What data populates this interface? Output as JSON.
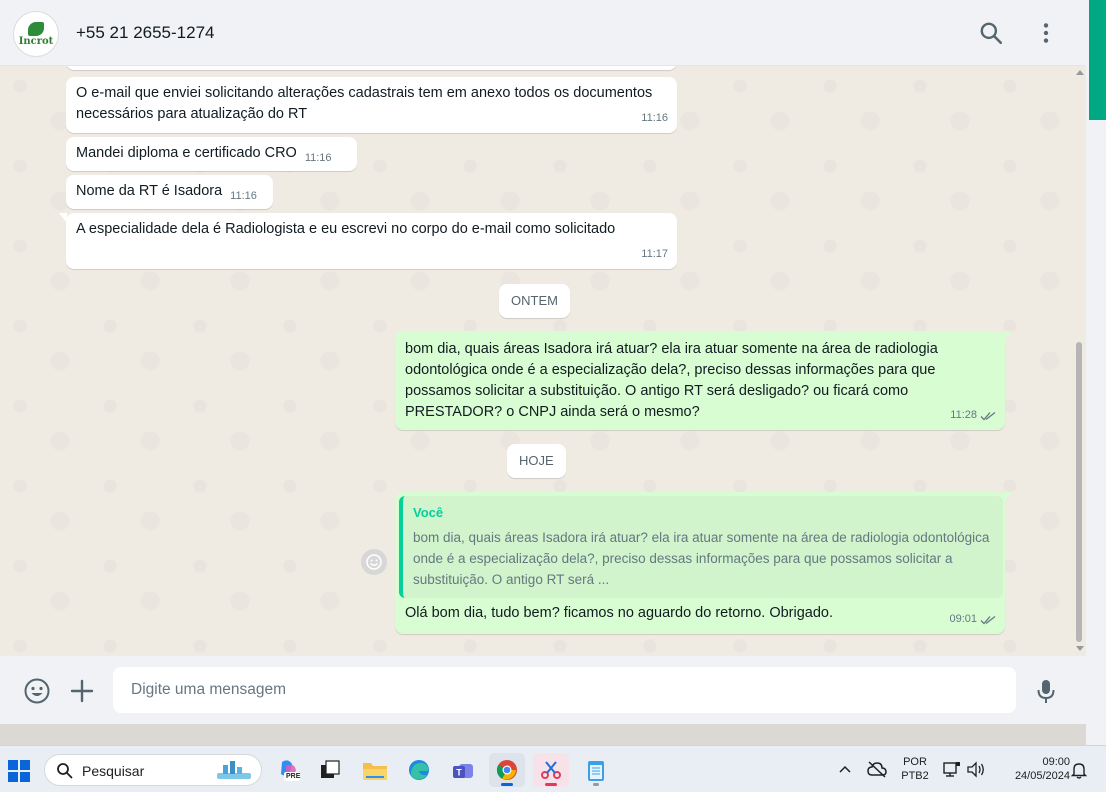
{
  "contact": {
    "name": "+55 21 2655-1274",
    "avatar_text": "Incrot"
  },
  "messages_in": [
    {
      "text": "O e-mail que enviei solicitando alterações cadastrais tem em anexo todos os documentos necessários para atualização do RT",
      "time": "11:16"
    },
    {
      "text": "Mandei diploma e certificado CRO",
      "time": "11:16"
    },
    {
      "text": "Nome da RT é Isadora",
      "time": "11:16"
    },
    {
      "text": "A especialidade dela é Radiologista e eu escrevi no corpo do e-mail como solicitado",
      "time": "11:17"
    }
  ],
  "dividers": {
    "yesterday": "ONTEM",
    "today": "HOJE"
  },
  "outgoing_1": {
    "text": "bom dia, quais áreas Isadora irá atuar?  ela ira atuar somente na área de radiologia odontológica onde é a especialização dela?, preciso dessas informações para que possamos solicitar a substituição. O antigo RT será desligado? ou ficará como PRESTADOR? o CNPJ ainda será o mesmo?",
    "time": "11:28"
  },
  "outgoing_2": {
    "quote_author": "Você",
    "quote_text": "bom dia, quais áreas Isadora irá atuar?  ela ira atuar somente na área de radiologia odontológica onde é a especialização dela?, preciso dessas informações para que possamos solicitar a substituição. O antigo RT será ...",
    "text": "Olá bom dia, tudo bem? ficamos no aguardo do retorno. Obrigado.",
    "time": "09:01"
  },
  "composer": {
    "placeholder": "Digite uma mensagem"
  },
  "taskbar": {
    "search_label": "Pesquisar",
    "lang_line1": "POR",
    "lang_line2": "PTB2",
    "clock_time": "09:00",
    "clock_date": "24/05/2024",
    "copilot_badge": "PRE"
  },
  "colors": {
    "accent": "#00a884",
    "outgoing": "#d9fdd3",
    "incoming": "#ffffff",
    "quote_author": "#06cf9c"
  }
}
